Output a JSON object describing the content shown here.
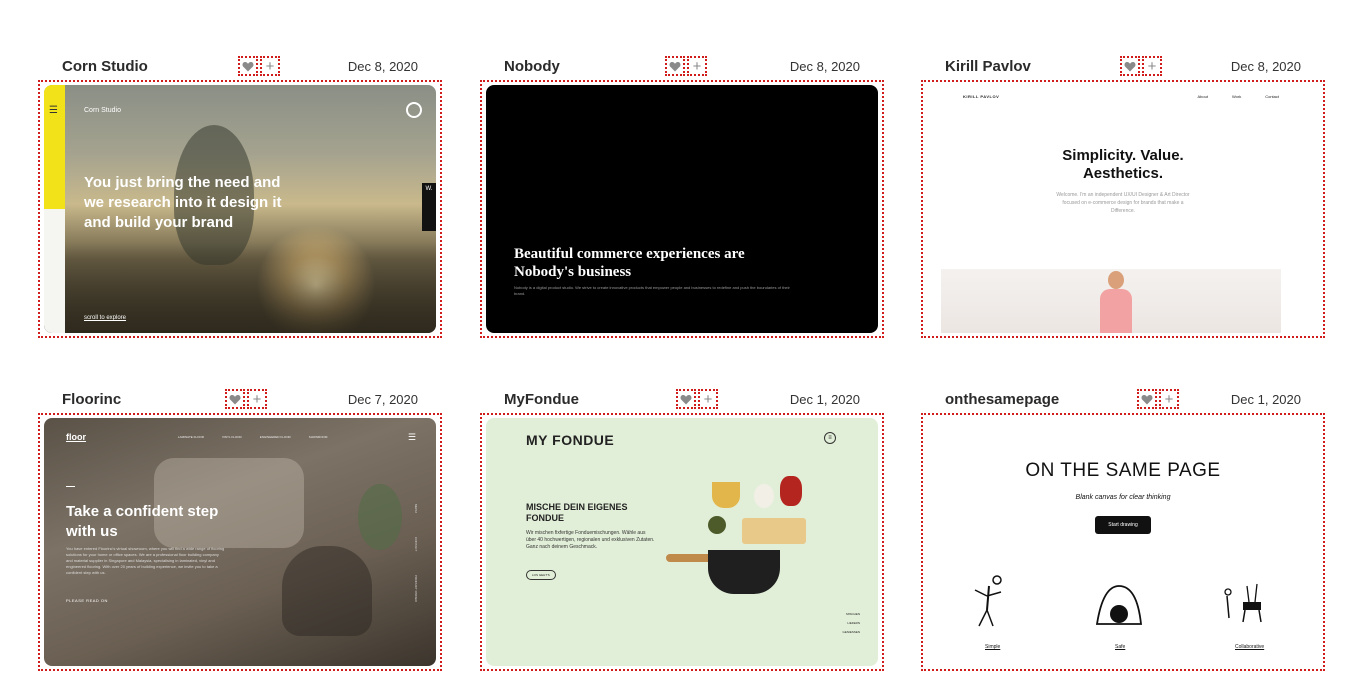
{
  "cards": [
    {
      "title": "Corn Studio",
      "date": "Dec 8, 2020",
      "preview": {
        "brand": "Corn Studio",
        "headline": "You just bring the need and we research into it design it and build your brand",
        "scroll_cta": "scroll to explore",
        "badge": "W."
      }
    },
    {
      "title": "Nobody",
      "date": "Dec 8, 2020",
      "preview": {
        "headline": "Beautiful commerce experiences are Nobody's business",
        "description": "Nobody is a digital product studio. We strive to create innovative products that empower people and businesses to redefine and push the boundaries of their brand."
      }
    },
    {
      "title": "Kirill Pavlov",
      "date": "Dec 8, 2020",
      "preview": {
        "brand": "KIRILL PAVLOV",
        "nav": [
          "About",
          "Work",
          "Contact"
        ],
        "headline": "Simplicity. Value. Aesthetics.",
        "description": "Welcome. I'm an independent UX/UI Designer & Art Director focused on e-commerce design for brands that make a Difference."
      }
    },
    {
      "title": "Floorinc",
      "date": "Dec 7, 2020",
      "preview": {
        "brand": "floor",
        "nav": [
          "LAMINATE FLOOR",
          "VINYL FLOOR",
          "ENGINEERED FLOOR",
          "SHOWROOM"
        ],
        "headline": "Take a confident step with us",
        "description": "You have entered Floorinc's virtual showroom, where you will find a wide range of flooring solutions for your home or office spaces. We are a professional floor building company and material supplier in Singapore and Malaysia, specialising in laminated, vinyl and engineered flooring. With over 20 years of building experience, we invite you to take a confident step with us.",
        "cta": "PLEASE READ ON",
        "side_links": [
          "MENU",
          "CONTACT",
          "PRODUCT FINDER"
        ]
      }
    },
    {
      "title": "MyFondue",
      "date": "Dec 1, 2020",
      "preview": {
        "brand": "MY FONDUE",
        "headline": "MISCHE DEIN EIGENES FONDUE",
        "description": "Wir mischen fixfertige Fonduemischungen. Wähle aus über 40 hochwertigen, regionalen und exklusiven Zutaten. Ganz nach deinem Geschmack.",
        "button": "LOS GEHT'S",
        "steps": [
          "MISCHEN",
          "LIEFERN",
          "GENIESSEN"
        ]
      }
    },
    {
      "title": "onthesamepage",
      "date": "Dec 1, 2020",
      "preview": {
        "headline": "ON THE SAME PAGE",
        "description": "Blank canvas for clear thinking",
        "button": "Start drawing",
        "features": [
          "Simple",
          "Safe",
          "Collaborative"
        ]
      }
    }
  ]
}
